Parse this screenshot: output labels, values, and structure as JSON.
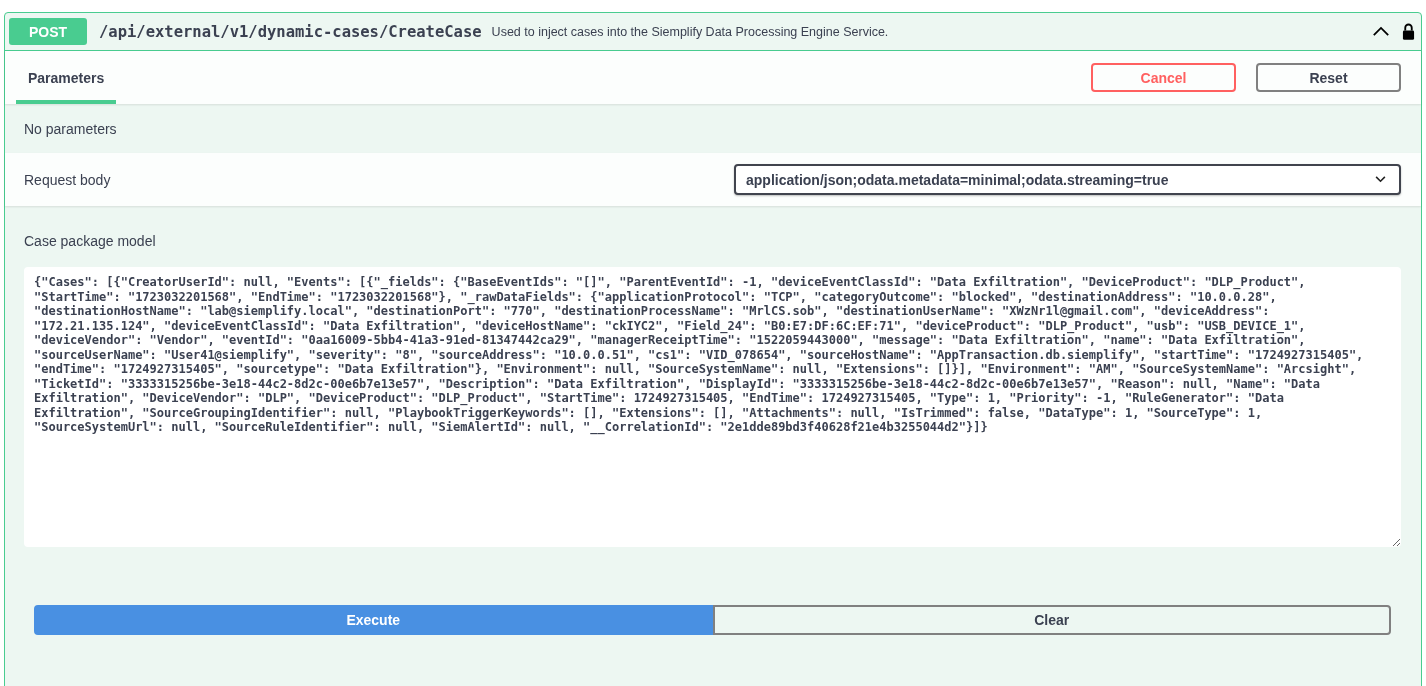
{
  "operation": {
    "method": "POST",
    "path": "/api/external/v1/dynamic-cases/CreateCase",
    "summary": "Used to inject cases into the Siemplify Data Processing Engine Service.",
    "expanded": true,
    "locked": true
  },
  "tabs": [
    {
      "label": "Parameters",
      "selected": true
    }
  ],
  "header_buttons": [
    {
      "label": "Cancel",
      "kind": "cancel"
    },
    {
      "label": "Reset",
      "kind": "reset"
    }
  ],
  "parameters_note": "No parameters",
  "request_body": {
    "label": "Request body",
    "content_type": "application/json;odata.metadata=minimal;odata.streaming=true"
  },
  "body_model": {
    "label": "Case package model",
    "value": "{\"Cases\": [{\"CreatorUserId\": null, \"Events\": [{\"_fields\": {\"BaseEventIds\": \"[]\", \"ParentEventId\": -1, \"deviceEventClassId\": \"Data Exfiltration\", \"DeviceProduct\": \"DLP_Product\", \"StartTime\": \"1723032201568\", \"EndTime\": \"1723032201568\"}, \"_rawDataFields\": {\"applicationProtocol\": \"TCP\", \"categoryOutcome\": \"blocked\", \"destinationAddress\": \"10.0.0.28\", \"destinationHostName\": \"lab@siemplify.local\", \"destinationPort\": \"770\", \"destinationProcessName\": \"MrlCS.sob\", \"destinationUserName\": \"XWzNr1l@gmail.com\", \"deviceAddress\": \"172.21.135.124\", \"deviceEventClassId\": \"Data Exfiltration\", \"deviceHostName\": \"ckIYC2\", \"Field_24\": \"B0:E7:DF:6C:EF:71\", \"deviceProduct\": \"DLP_Product\", \"usb\": \"USB_DEVICE_1\", \"deviceVendor\": \"Vendor\", \"eventId\": \"0aa16009-5bb4-41a3-91ed-81347442ca29\", \"managerReceiptTime\": \"1522059443000\", \"message\": \"Data Exfiltration\", \"name\": \"Data Exfiltration\", \"sourceUserName\": \"User41@siemplify\", \"severity\": \"8\", \"sourceAddress\": \"10.0.0.51\", \"cs1\": \"VID_078654\", \"sourceHostName\": \"AppTransaction.db.siemplify\", \"startTime\": \"1724927315405\", \"endTime\": \"1724927315405\", \"sourcetype\": \"Data Exfiltration\"}, \"Environment\": null, \"SourceSystemName\": null, \"Extensions\": []}], \"Environment\": \"AM\", \"SourceSystemName\": \"Arcsight\", \"TicketId\": \"3333315256be-3e18-44c2-8d2c-00e6b7e13e57\", \"Description\": \"Data Exfiltration\", \"DisplayId\": \"3333315256be-3e18-44c2-8d2c-00e6b7e13e57\", \"Reason\": null, \"Name\": \"Data Exfiltration\", \"DeviceVendor\": \"DLP\", \"DeviceProduct\": \"DLP_Product\", \"StartTime\": 1724927315405, \"EndTime\": 1724927315405, \"Type\": 1, \"Priority\": -1, \"RuleGenerator\": \"Data Exfiltration\", \"SourceGroupingIdentifier\": null, \"PlaybookTriggerKeywords\": [], \"Extensions\": [], \"Attachments\": null, \"IsTrimmed\": false, \"DataType\": 1, \"SourceType\": 1, \"SourceSystemUrl\": null, \"SourceRuleIdentifier\": null, \"SiemAlertId\": null, \"__CorrelationId\": \"2e1dde89bd3f40628f21e4b3255044d2\"}]}"
  },
  "action_buttons": [
    {
      "label": "Execute",
      "kind": "execute"
    },
    {
      "label": "Clear",
      "kind": "clear"
    }
  ]
}
